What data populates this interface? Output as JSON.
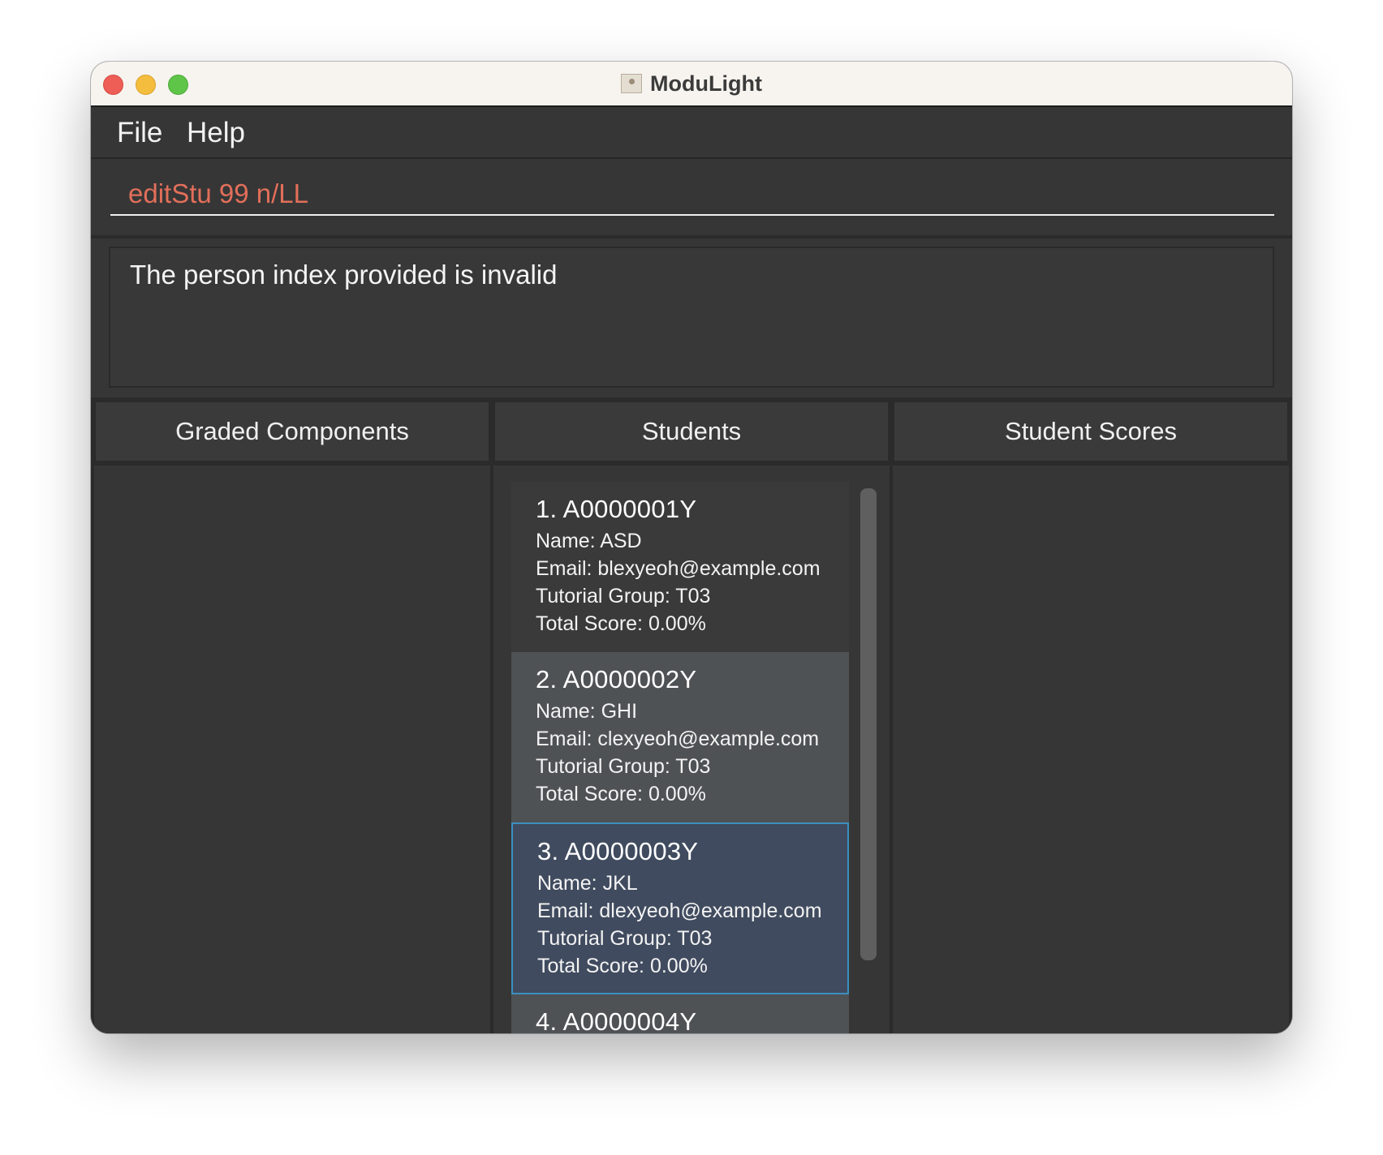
{
  "window": {
    "title": "ModuLight"
  },
  "menu": {
    "file": "File",
    "help": "Help"
  },
  "command": {
    "value": "editStu 99 n/LL"
  },
  "result": {
    "message": "The person index provided is invalid"
  },
  "panels": {
    "graded_components": "Graded Components",
    "students": "Students",
    "student_scores": "Student Scores"
  },
  "students": [
    {
      "heading": "1.  A0000001Y",
      "name": "Name: ASD",
      "email": "Email: blexyeoh@example.com",
      "tutorial": "Tutorial Group: T03",
      "score": "Total Score: 0.00%"
    },
    {
      "heading": "2.  A0000002Y",
      "name": "Name: GHI",
      "email": "Email: clexyeoh@example.com",
      "tutorial": "Tutorial Group: T03",
      "score": "Total Score: 0.00%"
    },
    {
      "heading": "3.  A0000003Y",
      "name": "Name: JKL",
      "email": "Email: dlexyeoh@example.com",
      "tutorial": "Tutorial Group: T03",
      "score": "Total Score: 0.00%",
      "selected": true
    },
    {
      "heading": "4.  A0000004Y"
    }
  ],
  "colors": {
    "command_text": "#e26f5a",
    "selected_border": "#3b8fbf",
    "selected_background": "#404b5f"
  }
}
